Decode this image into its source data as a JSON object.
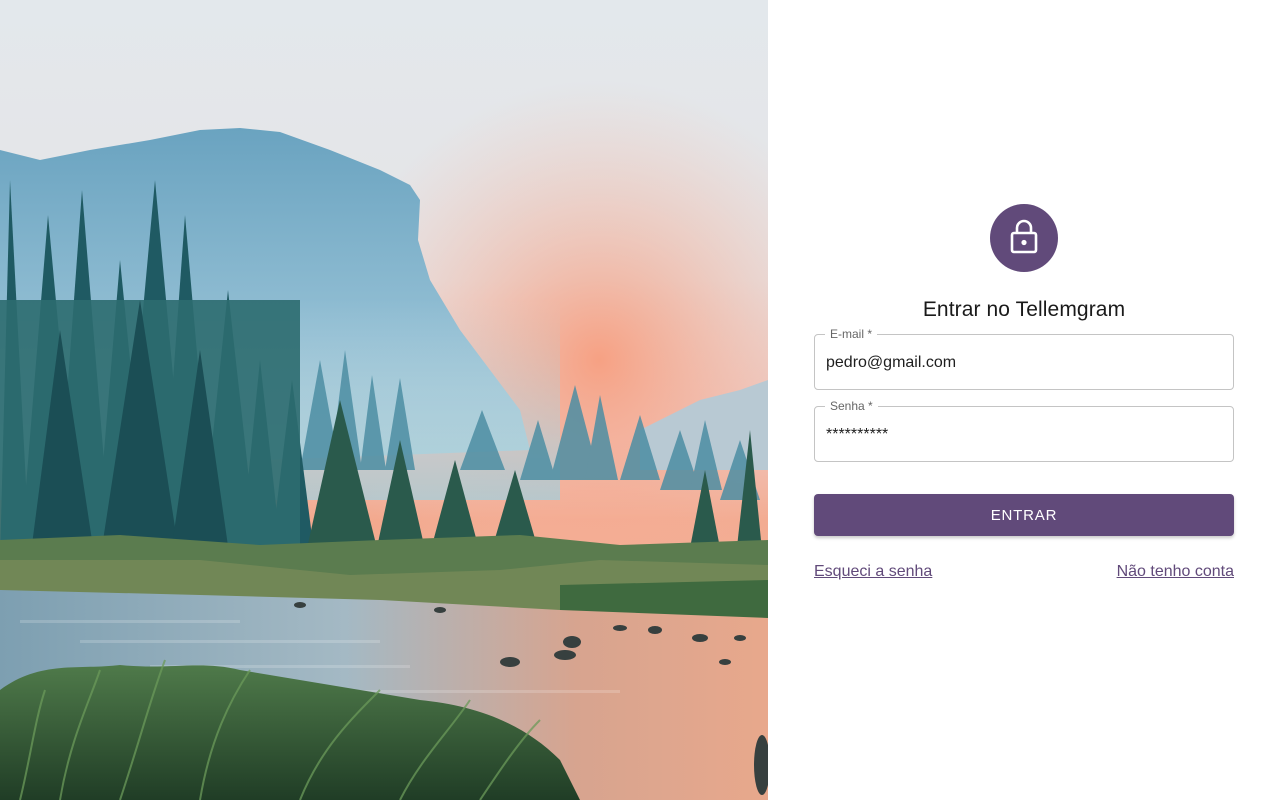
{
  "login": {
    "title": "Entrar no Tellemgram",
    "lock_icon": "lock-icon",
    "email": {
      "label": "E-mail *",
      "value": "pedro@gmail.com"
    },
    "password": {
      "label": "Senha *",
      "value": "**********"
    },
    "submit_label": "ENTRAR",
    "forgot_label": "Esqueci a senha",
    "signup_label": "Não tenho conta"
  },
  "colors": {
    "accent": "#614a7a",
    "border": "#c4c4c4",
    "label": "#666666"
  },
  "hero": {
    "image": "mountain-river-sunset-photo"
  }
}
